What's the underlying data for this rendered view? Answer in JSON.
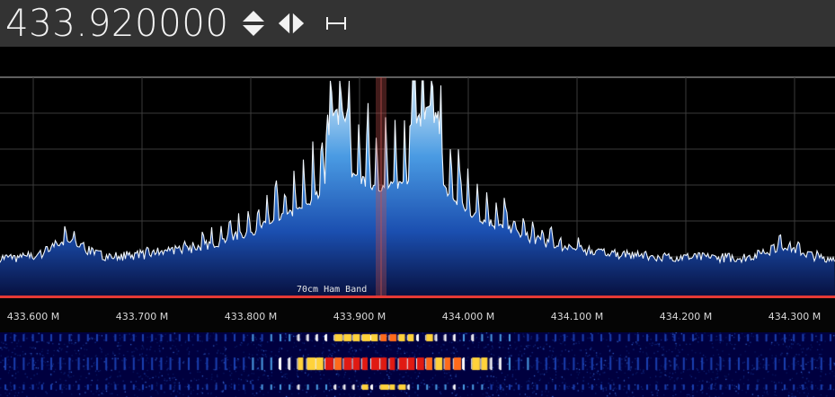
{
  "frequency": {
    "display": "433.920000"
  },
  "controls": {
    "step_icon": "up-down-triangles-icon",
    "tune_icon": "left-right-triangles-icon",
    "bandwidth_icon": "horizontal-span-icon"
  },
  "spectrum": {
    "center_mhz": 433.92,
    "tick_labels": [
      "433.600 M",
      "433.700 M",
      "433.800 M",
      "433.900 M",
      "434.000 M",
      "434.100 M",
      "434.200 M",
      "434.300 M"
    ],
    "band": {
      "label": "70cm Ham Band",
      "color": "#e53935"
    },
    "colors": {
      "background": "#000000",
      "grid": "#3a3a3a",
      "trace": "#e8f0f8",
      "fill_top": "#cfe6f5",
      "fill_mid": "#2a7fd4",
      "fill_bottom": "#08124a",
      "marker": "#c0504d"
    }
  },
  "waterfall": {
    "colors": [
      "#00004a",
      "#0a2a9a",
      "#2f7fe0",
      "#ffffff",
      "#ffcc33",
      "#ff4a1a",
      "#c81010"
    ]
  }
}
